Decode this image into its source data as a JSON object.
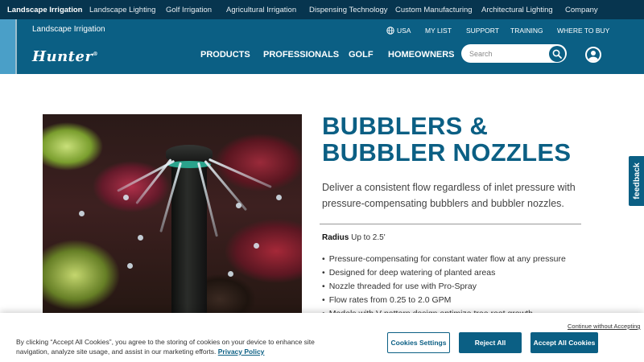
{
  "topbar": {
    "items": [
      {
        "label": "Landscape Irrigation",
        "active": true
      },
      {
        "label": "Landscape Lighting"
      },
      {
        "label": "Golf Irrigation"
      },
      {
        "label": "Agricultural Irrigation"
      },
      {
        "label": "Dispensing Technology"
      },
      {
        "label": "Custom Manufacturing"
      },
      {
        "label": "Architectural Lighting"
      },
      {
        "label": "Company"
      }
    ]
  },
  "header": {
    "subtitle": "Landscape Irrigation",
    "logo": "Hunter",
    "logo_mark": "®",
    "utility": {
      "region": "USA",
      "my_list": "MY LIST",
      "support": "SUPPORT",
      "training": "TRAINING",
      "where_to_buy": "WHERE TO BUY"
    },
    "nav": {
      "products": "PRODUCTS",
      "professionals": "PROFESSIONALS",
      "golf": "GOLF",
      "homeowners": "HOMEOWNERS"
    },
    "search_placeholder": "Search",
    "colors": {
      "dark": "#07354f",
      "primary": "#0b5f84",
      "accent_stripe": "#4a9fc8"
    }
  },
  "product": {
    "title_line1": "BUBBLERS &",
    "title_line2": "BUBBLER NOZZLES",
    "description": "Deliver a consistent flow regardless of inlet pressure with pressure-compensating bubblers and bubbler nozzles.",
    "spec_label": "Radius",
    "spec_value": "Up to 2.5'",
    "bullets": [
      "Pressure-compensating for constant water flow at any pressure",
      "Designed for deep watering of planted areas",
      "Nozzle threaded for use with Pro-Spray",
      "Flow rates from 0.25 to 2.0 GPM",
      "Models with V-pattern design optimize tree root growth"
    ]
  },
  "feedback": {
    "label": "feedback"
  },
  "cookie": {
    "text": "By clicking “Accept All Cookies”, you agree to the storing of cookies on your device to enhance site navigation, analyze site usage, and assist in our marketing efforts.",
    "privacy_link": "Privacy Policy",
    "continue_without": "Continue without Accepting",
    "settings": "Cookies Settings",
    "reject": "Reject All",
    "accept": "Accept All Cookies"
  }
}
